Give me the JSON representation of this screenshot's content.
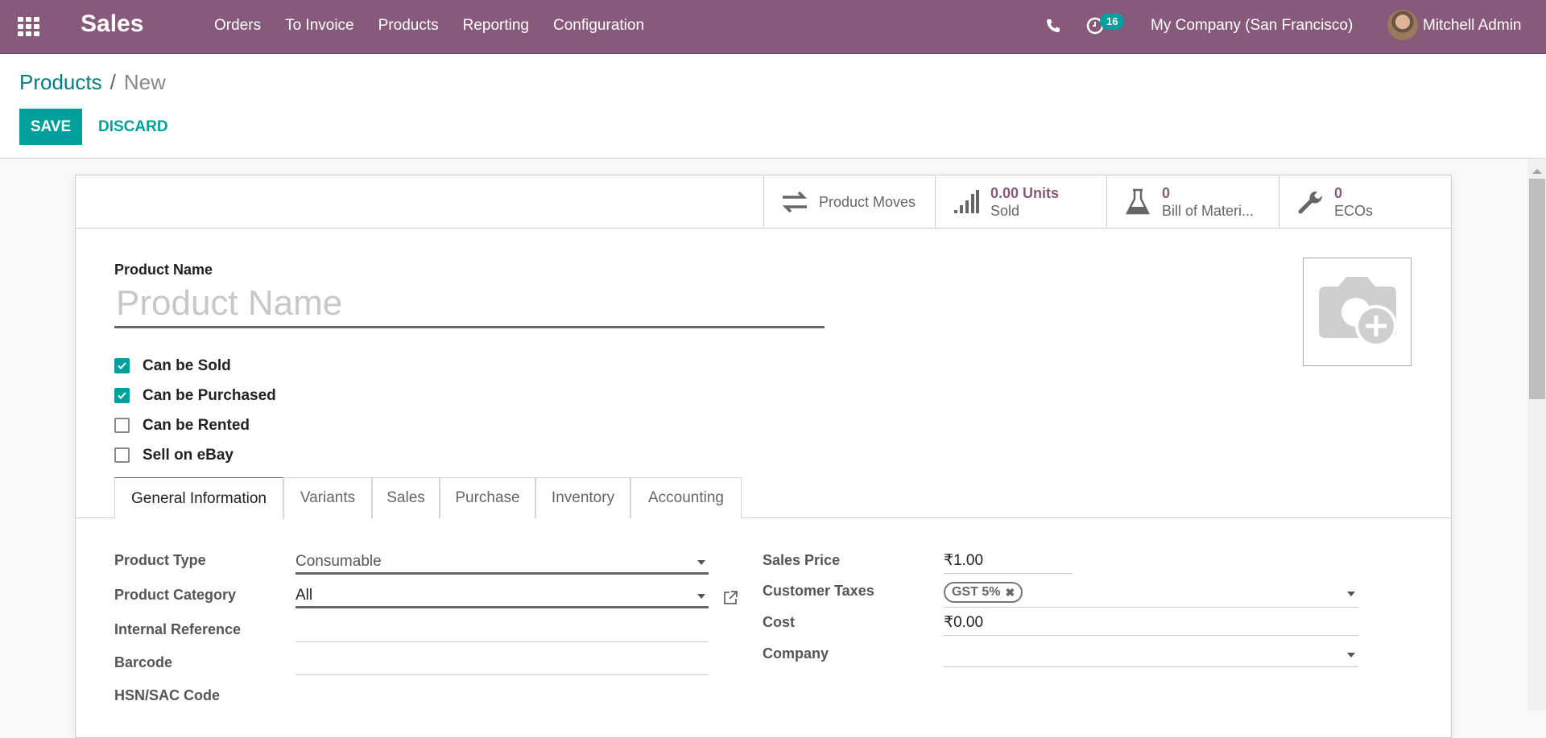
{
  "navbar": {
    "app_name": "Sales",
    "menu": [
      "Orders",
      "To Invoice",
      "Products",
      "Reporting",
      "Configuration"
    ],
    "activity_count": "16",
    "company": "My Company (San Francisco)",
    "user": "Mitchell Admin",
    "brand_color": "#875a7b"
  },
  "breadcrumb": {
    "parent": "Products",
    "separator": "/",
    "current": "New"
  },
  "actions": {
    "save": "SAVE",
    "discard": "DISCARD"
  },
  "smart_buttons": [
    {
      "icon": "transfer-arrows-icon",
      "value": "",
      "label": "Product Moves"
    },
    {
      "icon": "signal-bars-icon",
      "value": "0.00 Units",
      "label": "Sold"
    },
    {
      "icon": "flask-icon",
      "value": "0",
      "label": "Bill of Materi..."
    },
    {
      "icon": "wrench-icon",
      "value": "0",
      "label": "ECOs"
    }
  ],
  "form": {
    "name_label": "Product Name",
    "name_placeholder": "Product Name",
    "name_value": "",
    "checkboxes": [
      {
        "label": "Can be Sold",
        "checked": true
      },
      {
        "label": "Can be Purchased",
        "checked": true
      },
      {
        "label": "Can be Rented",
        "checked": false
      },
      {
        "label": "Sell on eBay",
        "checked": false
      }
    ],
    "tabs": [
      "General Information",
      "Variants",
      "Sales",
      "Purchase",
      "Inventory",
      "Accounting"
    ],
    "active_tab": "General Information",
    "left_fields": [
      {
        "label": "Product Type",
        "value": "Consumable"
      },
      {
        "label": "Product Category",
        "value": "All"
      },
      {
        "label": "Internal Reference",
        "value": ""
      },
      {
        "label": "Barcode",
        "value": ""
      },
      {
        "label": "HSN/SAC Code",
        "value": ""
      }
    ],
    "right_fields": [
      {
        "label": "Sales Price",
        "value": "₹1.00"
      },
      {
        "label": "Customer Taxes",
        "value": "",
        "tags": [
          "GST 5%"
        ]
      },
      {
        "label": "Cost",
        "value": "₹0.00"
      },
      {
        "label": "Company",
        "value": ""
      }
    ]
  }
}
